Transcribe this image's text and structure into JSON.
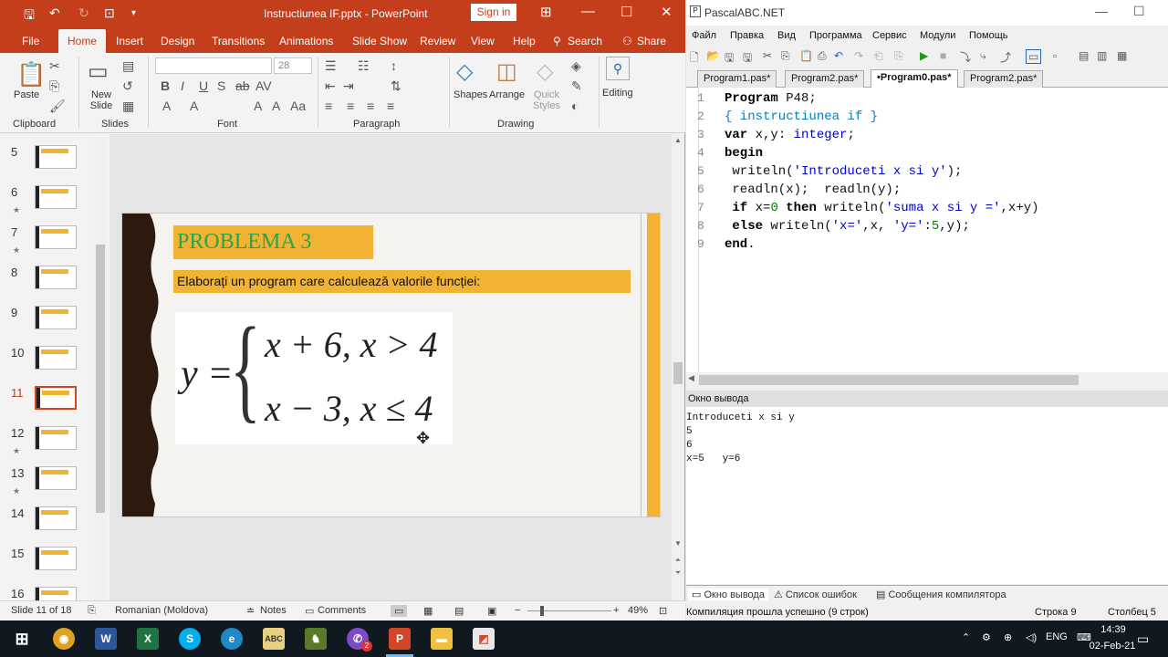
{
  "powerpoint": {
    "doc_title": "Instructiunea IF.pptx - PowerPoint",
    "sign_in": "Sign in",
    "tabs": [
      "File",
      "Home",
      "Insert",
      "Design",
      "Transitions",
      "Animations",
      "Slide Show",
      "Review",
      "View",
      "Help",
      "Search",
      "Share"
    ],
    "active_tab": "Home",
    "ribbon": {
      "paste": "Paste",
      "new_slide": "New Slide",
      "font_size": "28",
      "shapes": "Shapes",
      "arrange": "Arrange",
      "quick_styles": "Quick Styles",
      "editing": "Editing",
      "groups": [
        "Clipboard",
        "Slides",
        "Font",
        "Paragraph",
        "Drawing"
      ]
    },
    "thumbnails": [
      {
        "num": "5",
        "star": ""
      },
      {
        "num": "6",
        "star": "★"
      },
      {
        "num": "7",
        "star": "★"
      },
      {
        "num": "8",
        "star": ""
      },
      {
        "num": "9",
        "star": ""
      },
      {
        "num": "10",
        "star": ""
      },
      {
        "num": "11",
        "star": ""
      },
      {
        "num": "12",
        "star": "★"
      },
      {
        "num": "13",
        "star": "★"
      },
      {
        "num": "14",
        "star": ""
      },
      {
        "num": "15",
        "star": ""
      },
      {
        "num": "16",
        "star": ""
      }
    ],
    "selected_slide": "11",
    "slide": {
      "title": "PROBLEMA 3",
      "description": "Elaborați un program care calculează valorile funcției:",
      "formula": {
        "lhs": "y =",
        "line1": "x + 6,  x > 4",
        "line2": "x − 3,  x ≤ 4"
      }
    },
    "status": {
      "slide_info": "Slide 11 of 18",
      "language": "Romanian (Moldova)",
      "notes": "Notes",
      "comments": "Comments",
      "zoom": "49%"
    },
    "colors": {
      "accent": "#c43e1c",
      "slide_bar": "#f2b233",
      "title_text": "#2aa44a"
    }
  },
  "pascal": {
    "title": "PascalABC.NET",
    "menu": [
      "Файл",
      "Правка",
      "Вид",
      "Программа",
      "Сервис",
      "Модули",
      "Помощь"
    ],
    "tabs": [
      "Program1.pas*",
      "Program2.pas*",
      "•Program0.pas*",
      "Program2.pas*"
    ],
    "active_tab": "•Program0.pas*",
    "code_lines": [
      "Program P48;",
      "{ instructiunea if }",
      "var x,y: integer;",
      "begin",
      " writeln('Introduceti x si y');",
      " readln(x);  readln(y);",
      " if x=0 then writeln('suma x si y =',x+y)",
      " else writeln('x=',x, 'y=':5,y);",
      "end."
    ],
    "output_header": "Окно вывода",
    "output_lines": [
      "Introduceti x si y",
      "5",
      "6",
      "x=5   y=6"
    ],
    "bottom_tabs": [
      "Окно вывода",
      "Список ошибок",
      "Сообщения компилятора"
    ],
    "status": {
      "message": "Компиляция прошла успешно (9 строк)",
      "row": "Строка  9",
      "col": "Столбец  5"
    }
  },
  "taskbar": {
    "time": "14:39",
    "date": "02-Feb-21",
    "lang": "ENG",
    "badge": "2"
  }
}
